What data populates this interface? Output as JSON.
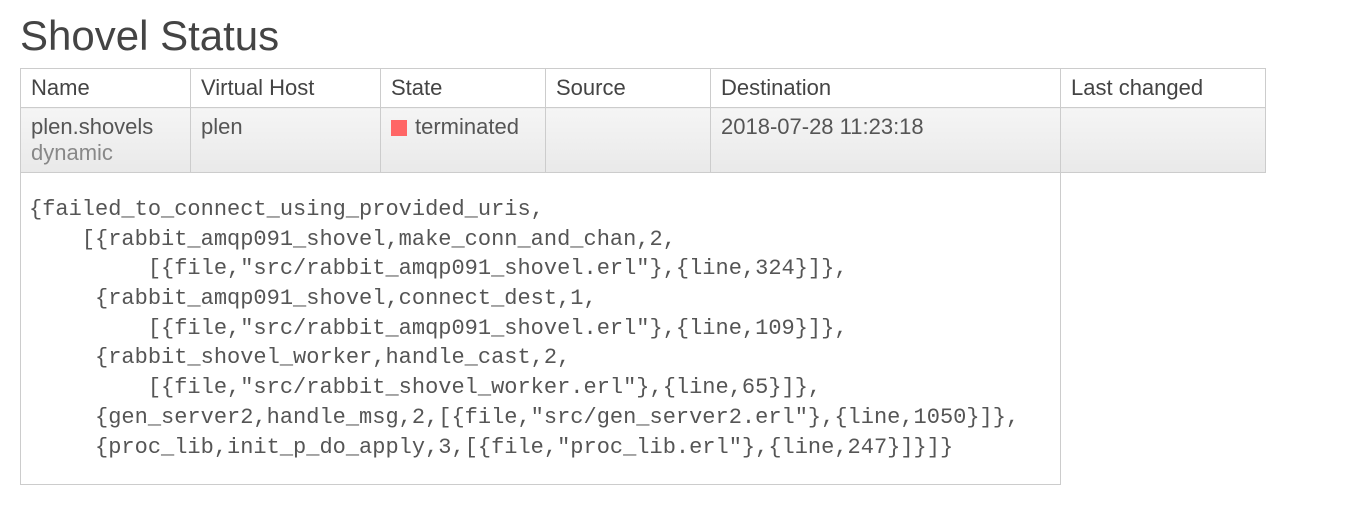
{
  "page": {
    "title": "Shovel Status"
  },
  "table": {
    "headers": {
      "name": "Name",
      "vhost": "Virtual Host",
      "state": "State",
      "source": "Source",
      "destination": "Destination",
      "last_changed": "Last changed"
    },
    "row": {
      "name": "plen.shovels",
      "name_sub": "dynamic",
      "vhost": "plen",
      "state": "terminated",
      "state_color": "#ff6666",
      "source": "",
      "destination": "2018-07-28 11:23:18",
      "last_changed": ""
    },
    "error_text": "{failed_to_connect_using_provided_uris,\n    [{rabbit_amqp091_shovel,make_conn_and_chan,2,\n         [{file,\"src/rabbit_amqp091_shovel.erl\"},{line,324}]},\n     {rabbit_amqp091_shovel,connect_dest,1,\n         [{file,\"src/rabbit_amqp091_shovel.erl\"},{line,109}]},\n     {rabbit_shovel_worker,handle_cast,2,\n         [{file,\"src/rabbit_shovel_worker.erl\"},{line,65}]},\n     {gen_server2,handle_msg,2,[{file,\"src/gen_server2.erl\"},{line,1050}]},\n     {proc_lib,init_p_do_apply,3,[{file,\"proc_lib.erl\"},{line,247}]}]}"
  }
}
